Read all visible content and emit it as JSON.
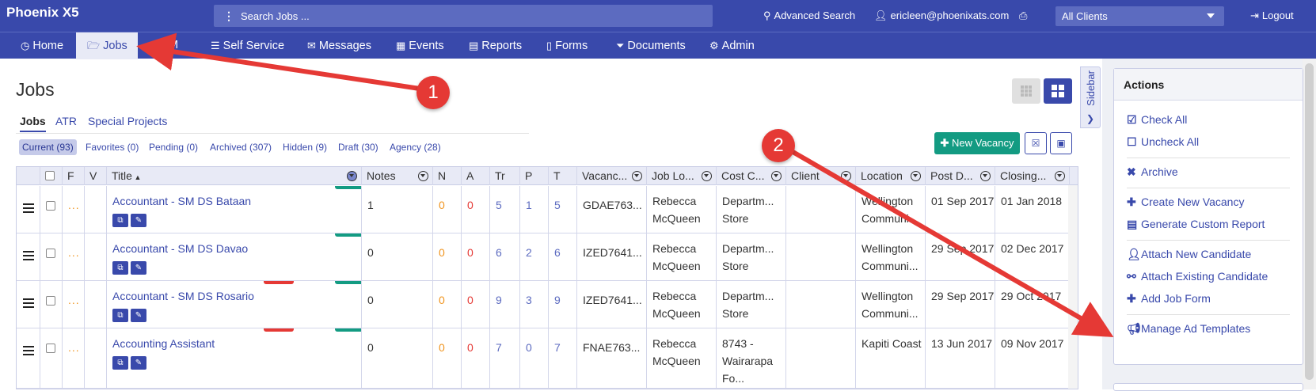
{
  "app": {
    "title": "Phoenix X5"
  },
  "search": {
    "placeholder": "Search Jobs ..."
  },
  "top": {
    "advanced_search": "Advanced Search",
    "user": "ericleen@phoenixats.com",
    "clients": "All Clients",
    "logout": "Logout"
  },
  "nav": [
    {
      "label": "Home",
      "icon": "clock-icon"
    },
    {
      "label": "Jobs",
      "icon": "folder-open-icon"
    },
    {
      "label": "CRM",
      "icon": "crm-icon"
    },
    {
      "label": "Self Service",
      "icon": "list-icon"
    },
    {
      "label": "Messages",
      "icon": "envelope-icon"
    },
    {
      "label": "Events",
      "icon": "calendar-icon"
    },
    {
      "label": "Reports",
      "icon": "book-icon"
    },
    {
      "label": "Forms",
      "icon": "file-icon"
    },
    {
      "label": "Documents",
      "icon": "filter-icon"
    },
    {
      "label": "Admin",
      "icon": "gear-icon"
    }
  ],
  "page": {
    "title": "Jobs"
  },
  "subtabs": [
    "Jobs",
    "ATR",
    "Special Projects"
  ],
  "filters": [
    "Current (93)",
    "Favorites (0)",
    "Pending (0)",
    "Archived (307)",
    "Hidden (9)",
    "Draft (30)",
    "Agency (28)"
  ],
  "sidebar_tab": "Sidebar",
  "new_vacancy": "New Vacancy",
  "table": {
    "headers": [
      "F",
      "V",
      "Title",
      "Notes",
      "N",
      "A",
      "Tr",
      "P",
      "T",
      "Vacanc...",
      "Job Lo...",
      "Cost C...",
      "Client",
      "Location",
      "Post D...",
      "Closing..."
    ],
    "rows": [
      {
        "title": "Accountant - SM DS Bataan",
        "notes": "1",
        "n": "0",
        "a": "0",
        "tr": "5",
        "p": "1",
        "t": "5",
        "vac": "GDAE763...",
        "jobloc": "Rebecca McQueen",
        "cost": "Departm... Store",
        "client": "",
        "location": "Wellington Communi...",
        "post": "01 Sep 2017",
        "closing": "01 Jan 2018"
      },
      {
        "title": "Accountant - SM DS Davao",
        "notes": "0",
        "n": "0",
        "a": "0",
        "tr": "6",
        "p": "2",
        "t": "6",
        "vac": "IZED7641...",
        "jobloc": "Rebecca McQueen",
        "cost": "Departm... Store",
        "client": "",
        "location": "Wellington Communi...",
        "post": "29 Sep 2017",
        "closing": "02 Dec 2017"
      },
      {
        "title": "Accountant - SM DS Rosario",
        "notes": "0",
        "n": "0",
        "a": "0",
        "tr": "9",
        "p": "3",
        "t": "9",
        "vac": "IZED7641...",
        "jobloc": "Rebecca McQueen",
        "cost": "Departm... Store",
        "client": "",
        "location": "Wellington Communi...",
        "post": "29 Sep 2017",
        "closing": "29 Oct 2017"
      },
      {
        "title": "Accounting Assistant",
        "notes": "0",
        "n": "0",
        "a": "0",
        "tr": "7",
        "p": "0",
        "t": "7",
        "vac": "FNAE763...",
        "jobloc": "Rebecca McQueen",
        "cost": "8743 - Wairarapa Fo...",
        "client": "",
        "location": "Kapiti Coast",
        "post": "13 Jun 2017",
        "closing": "09 Nov 2017"
      }
    ]
  },
  "actions": {
    "title": "Actions",
    "items": [
      {
        "label": "Check All",
        "icon": "check-square-icon"
      },
      {
        "label": "Uncheck All",
        "icon": "square-icon"
      },
      {
        "label": "Archive",
        "icon": "x-icon"
      },
      {
        "label": "Create New Vacancy",
        "icon": "plus-icon"
      },
      {
        "label": "Generate Custom Report",
        "icon": "report-icon"
      },
      {
        "label": "Attach New Candidate",
        "icon": "user-icon"
      },
      {
        "label": "Attach Existing Candidate",
        "icon": "paperclip-icon"
      },
      {
        "label": "Add Job Form",
        "icon": "plus-icon"
      },
      {
        "label": "Manage Ad Templates",
        "icon": "bullhorn-icon"
      }
    ]
  },
  "annotations": [
    "1",
    "2"
  ],
  "colors": {
    "primary": "#3949ab",
    "green": "#139b82",
    "annotation_red": "#e53935"
  }
}
